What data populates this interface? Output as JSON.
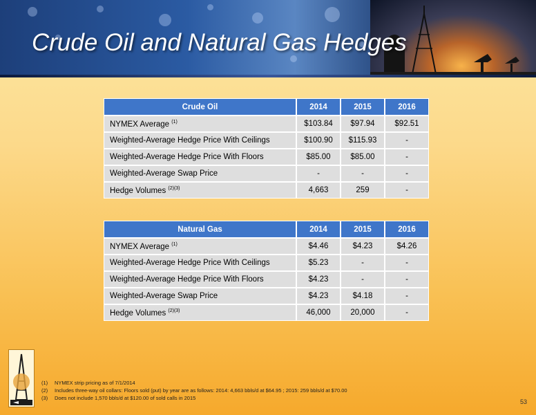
{
  "title": "Crude Oil and Natural Gas Hedges",
  "crude_table": {
    "headers": [
      "Crude Oil",
      "2014",
      "2015",
      "2016"
    ],
    "rows": [
      {
        "label": "NYMEX Average",
        "sup": "(1)",
        "v2014": "$103.84",
        "v2015": "$97.94",
        "v2016": "$92.51"
      },
      {
        "label": "Weighted-Average Hedge Price With Ceilings",
        "sup": "",
        "v2014": "$100.90",
        "v2015": "$115.93",
        "v2016": "-"
      },
      {
        "label": "Weighted-Average Hedge Price With Floors",
        "sup": "",
        "v2014": "$85.00",
        "v2015": "$85.00",
        "v2016": "-"
      },
      {
        "label": "Weighted-Average Swap Price",
        "sup": "",
        "v2014": "-",
        "v2015": "-",
        "v2016": "-"
      },
      {
        "label": "Hedge Volumes",
        "sup": "(2)(3)",
        "v2014": "4,663",
        "v2015": "259",
        "v2016": "-"
      }
    ]
  },
  "gas_table": {
    "headers": [
      "Natural Gas",
      "2014",
      "2015",
      "2016"
    ],
    "rows": [
      {
        "label": "NYMEX Average",
        "sup": "(1)",
        "v2014": "$4.46",
        "v2015": "$4.23",
        "v2016": "$4.26"
      },
      {
        "label": "Weighted-Average Hedge Price With Ceilings",
        "sup": "",
        "v2014": "$5.23",
        "v2015": "-",
        "v2016": "-"
      },
      {
        "label": "Weighted-Average Hedge Price With Floors",
        "sup": "",
        "v2014": "$4.23",
        "v2015": "-",
        "v2016": "-"
      },
      {
        "label": "Weighted-Average Swap Price",
        "sup": "",
        "v2014": "$4.23",
        "v2015": "$4.18",
        "v2016": "-"
      },
      {
        "label": "Hedge Volumes",
        "sup": "(2)(3)",
        "v2014": "46,000",
        "v2015": "20,000",
        "v2016": "-"
      }
    ]
  },
  "footnotes": [
    {
      "num": "(1)",
      "text": "NYMEX strip pricing as of 7/1/2014"
    },
    {
      "num": "(2)",
      "text": "Includes three-way oil collars: Floors sold (put) by year are as follows: 2014: 4,663 bbls/d at $64.95 ; 2015: 259 bbls/d at $70.00"
    },
    {
      "num": "(3)",
      "text": "Does not include 1,570 bbls/d at $120.00 of sold calls in 2015"
    }
  ],
  "page_number": "53"
}
